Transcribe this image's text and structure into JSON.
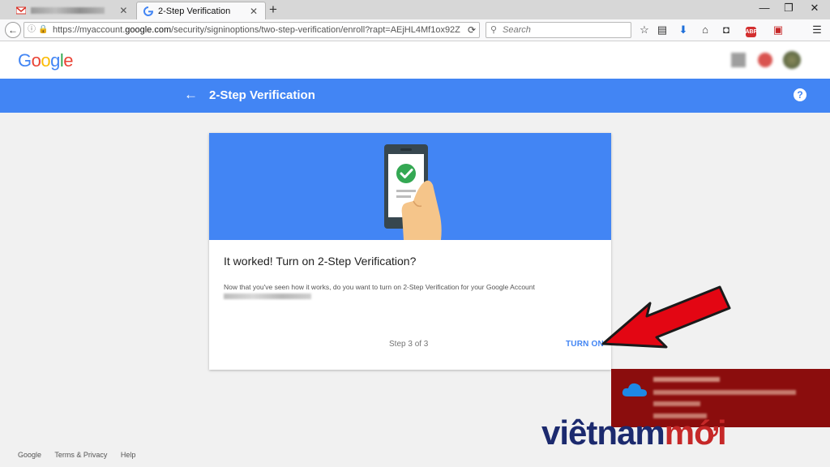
{
  "browser": {
    "active_tab_label": "2-Step Verification",
    "tab_close": "✕",
    "new_tab": "+",
    "url_prefix": "https://myaccount.",
    "url_domain": "google.com",
    "url_suffix": "/security/signinoptions/two-step-verification/enroll?rapt=AEjHL4Mf1ox92Z",
    "search_placeholder": "Search",
    "abp_label": "ABP"
  },
  "page": {
    "logo": [
      "G",
      "o",
      "o",
      "g",
      "l",
      "e"
    ],
    "logo_colors": [
      "#4285f4",
      "#ea4335",
      "#fbbc05",
      "#4285f4",
      "#34a853",
      "#ea4335"
    ],
    "header_title": "2-Step Verification",
    "help_label": "?"
  },
  "card": {
    "title": "It worked! Turn on 2-Step Verification?",
    "body": "Now that you've seen how it works, do you want to turn on 2-Step Verification for your Google Account",
    "step": "Step 3 of 3",
    "turn_on": "TURN ON"
  },
  "footer": {
    "links": [
      "Google",
      "Terms & Privacy",
      "Help"
    ]
  },
  "watermark": {
    "part1": "viêtnam",
    "part2": "mới"
  },
  "colors": {
    "google_blue": "#4285f4",
    "annotation_red": "#e30613",
    "notification_red": "#8b0d0d",
    "check_green": "#34a853"
  }
}
